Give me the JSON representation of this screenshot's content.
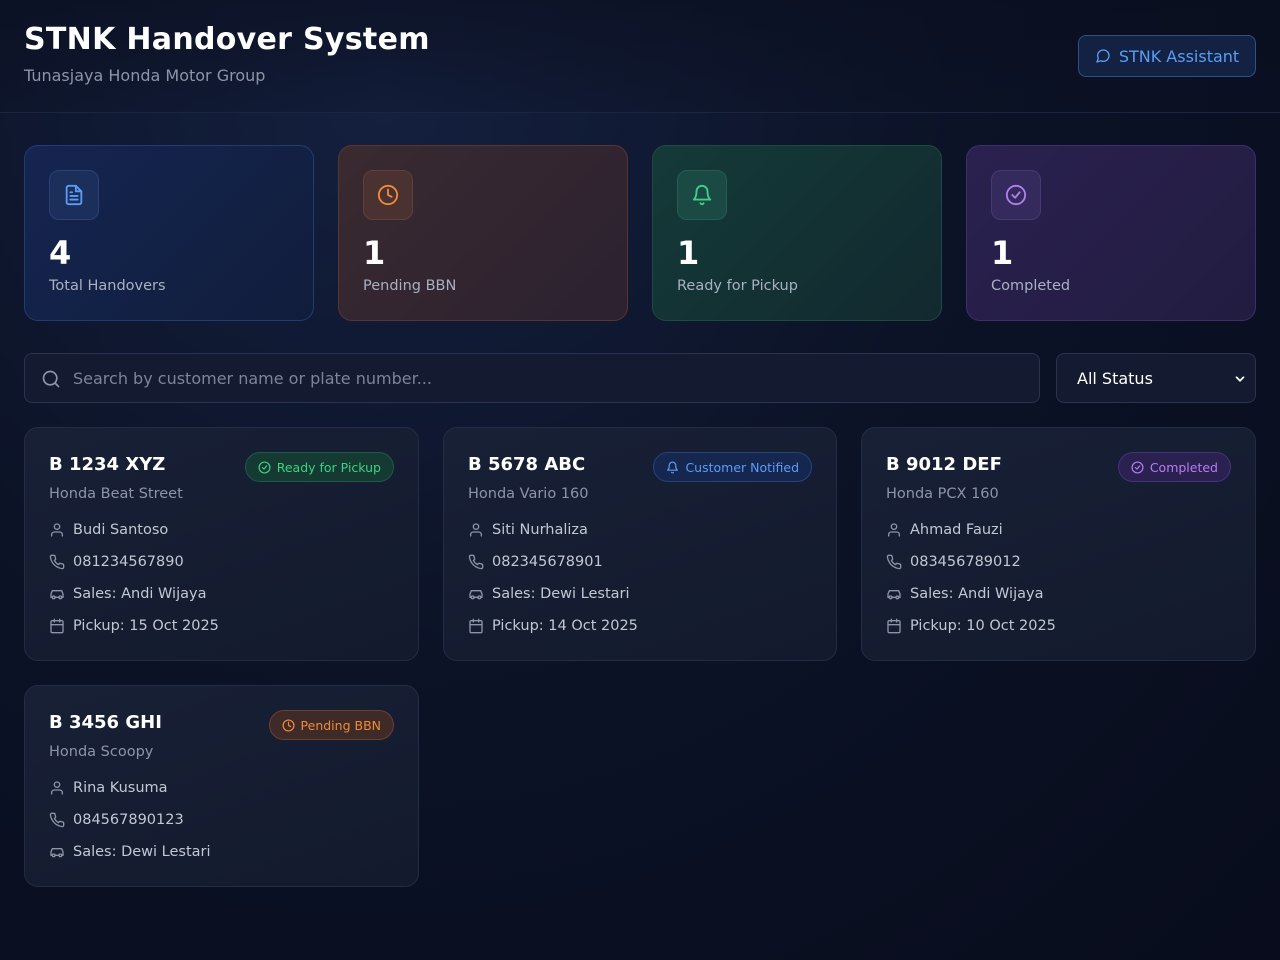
{
  "header": {
    "title": "STNK Handover System",
    "subtitle": "Tunasjaya Honda Motor Group",
    "assistant_label": "STNK Assistant"
  },
  "stats": [
    {
      "value": "4",
      "label": "Total Handovers",
      "icon": "document-icon",
      "color": "#5b9cf5"
    },
    {
      "value": "1",
      "label": "Pending BBN",
      "icon": "clock-icon",
      "color": "#f08a3c"
    },
    {
      "value": "1",
      "label": "Ready for Pickup",
      "icon": "bell-icon",
      "color": "#3fcf85"
    },
    {
      "value": "1",
      "label": "Completed",
      "icon": "check-circle-icon",
      "color": "#b57ef0"
    }
  ],
  "search": {
    "placeholder": "Search by customer name or plate number...",
    "value": ""
  },
  "filter": {
    "selected": "All Status"
  },
  "handovers": [
    {
      "plate": "B 1234 XYZ",
      "model": "Honda Beat Street",
      "status": "Ready for Pickup",
      "customer": "Budi Santoso",
      "phone": "081234567890",
      "sales": "Sales: Andi Wijaya",
      "pickup": "Pickup: 15 Oct 2025"
    },
    {
      "plate": "B 5678 ABC",
      "model": "Honda Vario 160",
      "status": "Customer Notified",
      "customer": "Siti Nurhaliza",
      "phone": "082345678901",
      "sales": "Sales: Dewi Lestari",
      "pickup": "Pickup: 14 Oct 2025"
    },
    {
      "plate": "B 9012 DEF",
      "model": "Honda PCX 160",
      "status": "Completed",
      "customer": "Ahmad Fauzi",
      "phone": "083456789012",
      "sales": "Sales: Andi Wijaya",
      "pickup": "Pickup: 10 Oct 2025"
    },
    {
      "plate": "B 3456 GHI",
      "model": "Honda Scoopy",
      "status": "Pending BBN",
      "customer": "Rina Kusuma",
      "phone": "084567890123",
      "sales": "Sales: Dewi Lestari"
    }
  ],
  "colors": {
    "accent_blue": "#5b9cf5",
    "status_ready": "#3fcf85",
    "status_pending": "#f08a3c",
    "status_completed": "#b57ef0"
  }
}
